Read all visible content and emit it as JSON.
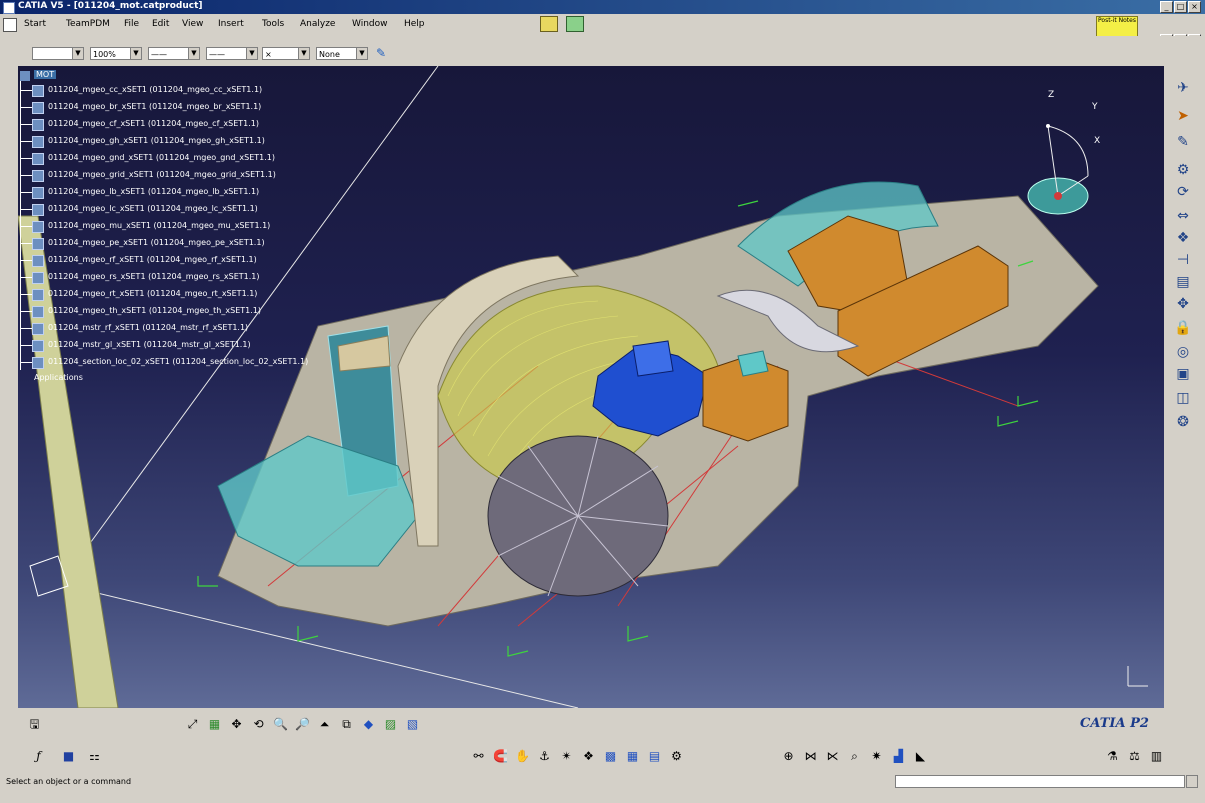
{
  "window": {
    "title": "CATIA V5 - [011204_mot.catproduct]",
    "controls": [
      "_",
      "□",
      "×"
    ]
  },
  "menu": {
    "items": [
      "Start",
      "TeamPDM",
      "File",
      "Edit",
      "View",
      "Insert",
      "Tools",
      "Analyze",
      "Window",
      "Help"
    ]
  },
  "toolbar": {
    "combo_color": "",
    "combo_zoom": "100%",
    "combo_line1": "——",
    "combo_line2": "——",
    "combo_point": "×",
    "combo_layer": "None"
  },
  "postit": {
    "label": "Post-it Notes"
  },
  "tree": {
    "root": "MOT",
    "items": [
      "011204_mgeo_cc_xSET1 (011204_mgeo_cc_xSET1.1)",
      "011204_mgeo_br_xSET1 (011204_mgeo_br_xSET1.1)",
      "011204_mgeo_cf_xSET1 (011204_mgeo_cf_xSET1.1)",
      "011204_mgeo_gh_xSET1 (011204_mgeo_gh_xSET1.1)",
      "011204_mgeo_gnd_xSET1 (011204_mgeo_gnd_xSET1.1)",
      "011204_mgeo_grid_xSET1 (011204_mgeo_grid_xSET1.1)",
      "011204_mgeo_lb_xSET1 (011204_mgeo_lb_xSET1.1)",
      "011204_mgeo_lc_xSET1 (011204_mgeo_lc_xSET1.1)",
      "011204_mgeo_mu_xSET1 (011204_mgeo_mu_xSET1.1)",
      "011204_mgeo_pe_xSET1 (011204_mgeo_pe_xSET1.1)",
      "011204_mgeo_rf_xSET1 (011204_mgeo_rf_xSET1.1)",
      "011204_mgeo_rs_xSET1 (011204_mgeo_rs_xSET1.1)",
      "011204_mgeo_rt_xSET1 (011204_mgeo_rt_xSET1.1)",
      "011204_mgeo_th_xSET1 (011204_mgeo_th_xSET1.1)",
      "011204_mstr_rf_xSET1 (011204_mstr_rf_xSET1.1)",
      "011204_mstr_gl_xSET1 (011204_mstr_gl_xSET1.1)",
      "011204_section_loc_02_xSET1 (011204_section_loc_02_xSET1.1)"
    ],
    "applications": "Applications"
  },
  "compass": {
    "x": "X",
    "y": "Y",
    "z": "Z"
  },
  "logo": {
    "text": "CATIA P2"
  },
  "status": {
    "text": "Select an object or a command"
  },
  "colors": {
    "accent": "#0a246a",
    "viewport_top": "#17173a",
    "viewport_bottom": "#5f6b97",
    "orange_box": "#d08a2e",
    "blue_part": "#1f4fd0",
    "teal_mesh": "#5fc8c8",
    "yellow_mesh": "#c9c94a",
    "base_plate": "#b9b4a4"
  },
  "icons": {
    "right_toolbar": [
      "fly-mode-icon",
      "select-icon",
      "sketch-icon",
      "assembly-icon",
      "rotate-icon",
      "measure-icon",
      "snap-icon",
      "constraint-icon",
      "analysis-icon",
      "pan-icon",
      "lock-icon",
      "normal-view-icon",
      "hide-show-icon",
      "2d-view-icon",
      "render-icon"
    ]
  }
}
